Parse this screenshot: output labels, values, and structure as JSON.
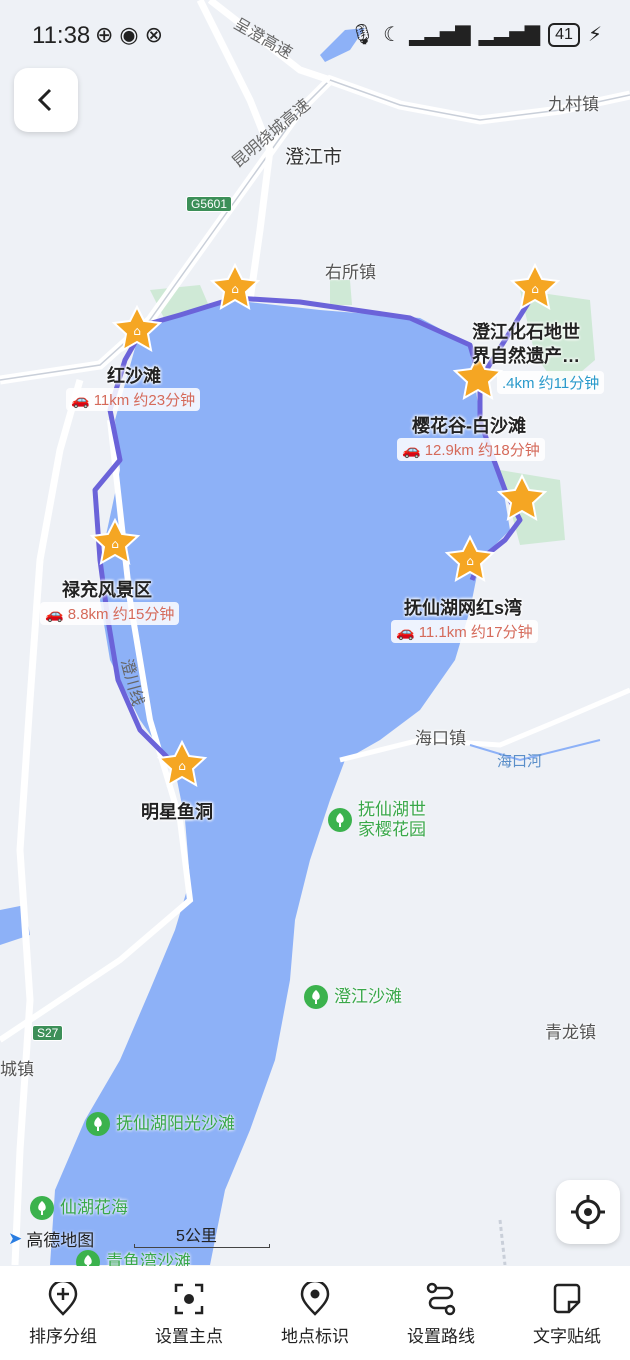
{
  "status_bar": {
    "time": "11:38",
    "battery": "41"
  },
  "map": {
    "towns": [
      "澄江市",
      "右所镇",
      "九村镇",
      "海口镇",
      "青龙镇",
      "城镇"
    ],
    "roads": [
      "呈澄高速",
      "昆明绕城高速",
      "澄川线"
    ],
    "road_shields": [
      "G5601",
      "S27"
    ],
    "rivers": [
      "海口河"
    ],
    "parks": [
      "抚仙湖世\n家樱花园",
      "澄江沙滩",
      "抚仙湖阳光沙滩",
      "仙湖花海",
      "青鱼湾沙滩"
    ],
    "stops": [
      {
        "name": "红沙滩",
        "segment": "11km 约23分钟"
      },
      {
        "name": "禄充风景区",
        "segment": "8.8km 约15分钟"
      },
      {
        "name": "明星鱼洞",
        "segment": ""
      },
      {
        "name": "澄江化石地世\n界自然遗产…",
        "segment": ".4km 约11分钟"
      },
      {
        "name": "樱花谷-白沙滩",
        "segment": "12.9km 约18分钟"
      },
      {
        "name": "抚仙湖网红s湾",
        "segment": "11.1km 约17分钟"
      }
    ],
    "scale_label": "5公里",
    "brand": "高德地图"
  },
  "toolbar": {
    "items": [
      {
        "label": "排序分组",
        "icon": "add-pin-icon"
      },
      {
        "label": "设置主点",
        "icon": "focus-point-icon"
      },
      {
        "label": "地点标识",
        "icon": "location-pin-icon"
      },
      {
        "label": "设置路线",
        "icon": "route-icon"
      },
      {
        "label": "文字贴纸",
        "icon": "sticker-icon"
      }
    ]
  },
  "colors": {
    "lake": "#8db1f7",
    "route": "#6b63d9",
    "marker": "#f5a623",
    "land": "#eef1f6",
    "green": "#3bb24d"
  }
}
